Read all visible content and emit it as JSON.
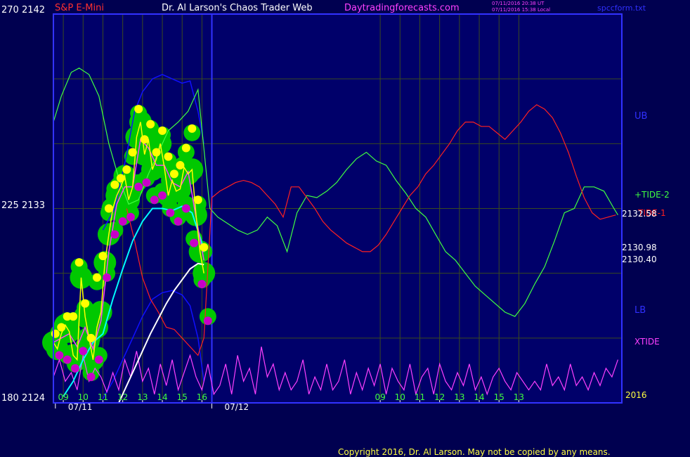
{
  "header": {
    "top_price_label": "270  2142",
    "instrument": "S&P E-Mini",
    "site_title": "Dr. Al Larson's Chaos Trader Web",
    "website": "Daytradingforecasts.com",
    "timestamp_utc": "07/11/2016 20:38 UT",
    "timestamp_local": "07/11/2016 15:38 Local",
    "filename": "spccform.txt"
  },
  "left_axis": {
    "mid_label": "225  2133",
    "bottom_label": "180  2124"
  },
  "right_labels": {
    "ub": "UB",
    "tide2": "+TIDE-2",
    "tide1": "TIDE-1",
    "price_1": "2132.58",
    "price_2": "2130.98",
    "price_3": "2130.40",
    "lb": "LB",
    "xtide": "XTIDE",
    "year": "2016"
  },
  "hour_labels": [
    "09",
    "10",
    "11",
    "12",
    "13",
    "14",
    "15",
    "16",
    "09",
    "10",
    "11",
    "12",
    "13",
    "14",
    "15",
    "13"
  ],
  "date_labels": [
    "07/11",
    "07/12"
  ],
  "copyright": "Copyright 2016, Dr. Al Larson. May not be copied by any means.",
  "colors": {
    "background": "#000050",
    "plot_area": "#00006a",
    "grid": "#3a4a20",
    "frame": "#3232ff",
    "price_bubble": "#00c800",
    "high_dot": "#ffff00",
    "low_dot": "#c800c8",
    "close_line": "#ffff00",
    "fast_ma": "#ff40ff",
    "ma_cyan": "#00ffff",
    "ma_white": "#ffffff",
    "upper_band": "#1010ff",
    "tide2": "#40ff40",
    "tide1": "#ff2020",
    "xtide": "#ff40ff",
    "header_red": "#ff3030",
    "header_pink": "#ff40ff"
  },
  "chart_data": {
    "type": "line",
    "ylim": [
      2124,
      2142
    ],
    "y_ticks": [
      2124,
      2133,
      2142
    ],
    "x_range": [
      8.5,
      37.2
    ],
    "session_break_x": 16.5,
    "series": [
      {
        "key": "price_close",
        "x": [
          8.5,
          8.7,
          8.9,
          9.1,
          9.3,
          9.5,
          9.7,
          9.9,
          10.1,
          10.3,
          10.5,
          10.7,
          10.9,
          11.1,
          11.3,
          11.5,
          11.7,
          11.9,
          12.1,
          12.3,
          12.5,
          12.7,
          12.9,
          13.1,
          13.3,
          13.5,
          13.7,
          13.9,
          14.1,
          14.3,
          14.5,
          14.7,
          14.9,
          15.1,
          15.3,
          15.5,
          15.7,
          15.9,
          16.1
        ],
        "y": [
          2126.8,
          2126.5,
          2127.2,
          2127.6,
          2127.3,
          2126.2,
          2126.0,
          2129.8,
          2128.0,
          2127.0,
          2126.0,
          2127.5,
          2128.2,
          2130.5,
          2131.8,
          2133.0,
          2133.6,
          2134.0,
          2134.5,
          2133.4,
          2134.0,
          2136.3,
          2137.0,
          2135.5,
          2136.2,
          2134.8,
          2135.3,
          2136.0,
          2134.9,
          2133.6,
          2134.3,
          2133.8,
          2133.9,
          2134.9,
          2134.6,
          2134.8,
          2132.7,
          2131.0,
          2130.0
        ]
      },
      {
        "key": "fast_ma",
        "x": [
          8.5,
          8.9,
          9.3,
          9.7,
          10.1,
          10.5,
          10.9,
          11.3,
          11.7,
          12.1,
          12.5,
          12.9,
          13.3,
          13.7,
          14.1,
          14.5,
          14.9,
          15.3,
          15.7,
          16.1
        ],
        "y": [
          2126.8,
          2127.0,
          2127.2,
          2126.6,
          2127.5,
          2126.5,
          2127.8,
          2131.0,
          2133.2,
          2134.0,
          2134.0,
          2136.2,
          2135.8,
          2135.0,
          2135.0,
          2134.2,
          2134.0,
          2134.7,
          2132.6,
          2130.6
        ]
      },
      {
        "key": "ma_cyan",
        "x": [
          9.0,
          9.5,
          10.0,
          10.5,
          11.0,
          11.5,
          12.0,
          12.5,
          13.0,
          13.5,
          14.0,
          14.5,
          15.0,
          15.5,
          16.0,
          16.1
        ],
        "y": [
          2124.3,
          2125.0,
          2126.0,
          2126.8,
          2127.2,
          2128.8,
          2130.2,
          2131.5,
          2132.4,
          2133.0,
          2133.0,
          2132.9,
          2133.1,
          2132.8,
          2131.4,
          2130.98
        ]
      },
      {
        "key": "ma_white",
        "x": [
          11.8,
          12.2,
          12.6,
          13.0,
          13.4,
          13.8,
          14.2,
          14.6,
          15.0,
          15.4,
          15.8,
          16.1
        ],
        "y": [
          2124.0,
          2124.8,
          2125.6,
          2126.4,
          2127.2,
          2127.9,
          2128.6,
          2129.2,
          2129.7,
          2130.2,
          2130.45,
          2130.4
        ]
      },
      {
        "key": "upper_band",
        "x": [
          11.0,
          11.6,
          12.2,
          12.6,
          13.0,
          13.5,
          14.0,
          14.5,
          15.0,
          15.4,
          15.8,
          16.1
        ],
        "y": [
          2132.0,
          2133.0,
          2135.5,
          2137.5,
          2138.4,
          2139.0,
          2139.2,
          2139.0,
          2138.8,
          2138.9,
          2137.5,
          2136.0
        ]
      },
      {
        "key": "lower_band",
        "x": [
          11.0,
          11.5,
          12.0,
          12.5,
          13.0,
          13.5,
          14.0,
          14.5,
          15.0,
          15.4,
          15.8,
          16.1
        ],
        "y": [
          2124.2,
          2125.0,
          2126.0,
          2127.0,
          2128.0,
          2128.8,
          2129.1,
          2129.2,
          2129.0,
          2128.5,
          2127.0,
          2125.0
        ]
      },
      {
        "key": "tide2",
        "x": [
          8.5,
          8.9,
          9.4,
          9.8,
          10.3,
          10.8,
          11.3,
          11.8,
          12.3,
          12.8,
          13.3,
          13.8,
          14.3,
          14.8,
          15.3,
          15.8,
          16.4,
          16.8,
          17.3,
          17.8,
          18.3,
          18.8,
          19.3,
          19.8,
          20.3,
          20.8,
          21.3,
          21.8,
          22.3,
          22.8,
          23.3,
          23.8,
          24.3,
          24.8,
          25.3,
          25.8,
          26.3,
          26.8,
          27.3,
          27.8,
          28.3,
          28.8,
          29.3,
          29.8,
          30.3,
          30.8,
          31.3,
          31.8,
          32.3,
          32.8,
          33.3,
          33.8,
          34.3,
          34.8,
          35.3,
          35.8,
          36.3,
          36.8,
          37.0
        ],
        "y": [
          2137.0,
          2138.2,
          2139.3,
          2139.5,
          2139.2,
          2138.2,
          2136.0,
          2134.4,
          2133.2,
          2133.4,
          2134.6,
          2135.6,
          2136.6,
          2137.0,
          2137.5,
          2138.5,
          2133.0,
          2132.6,
          2132.3,
          2132.0,
          2131.8,
          2132.0,
          2132.6,
          2132.2,
          2131.0,
          2132.8,
          2133.6,
          2133.5,
          2133.8,
          2134.2,
          2134.8,
          2135.3,
          2135.6,
          2135.2,
          2135.0,
          2134.3,
          2133.7,
          2133.0,
          2132.6,
          2131.8,
          2131.0,
          2130.6,
          2130.0,
          2129.4,
          2129.0,
          2128.6,
          2128.2,
          2128.0,
          2128.6,
          2129.5,
          2130.3,
          2131.5,
          2132.8,
          2133.0,
          2134.0,
          2134.0,
          2133.8,
          2133.0,
          2132.7
        ],
        "name": "+TIDE-2"
      },
      {
        "key": "tide1",
        "x": [
          12.2,
          12.6,
          13.0,
          13.4,
          13.8,
          14.2,
          14.6,
          15.0,
          15.4,
          15.8,
          16.1,
          16.5,
          16.9,
          17.3,
          17.7,
          18.1,
          18.5,
          18.9,
          19.3,
          19.7,
          20.1,
          20.5,
          20.9,
          21.3,
          21.7,
          22.1,
          22.5,
          22.9,
          23.3,
          23.7,
          24.1,
          24.5,
          24.9,
          25.3,
          25.7,
          26.1,
          26.5,
          26.9,
          27.3,
          27.7,
          28.1,
          28.5,
          28.9,
          29.3,
          29.7,
          30.1,
          30.5,
          30.9,
          31.3,
          31.7,
          32.1,
          32.5,
          32.9,
          33.3,
          33.7,
          34.1,
          34.5,
          34.9,
          35.3,
          35.7,
          36.1,
          36.5,
          36.9
        ],
        "y": [
          2133.0,
          2131.5,
          2129.8,
          2128.8,
          2128.2,
          2127.5,
          2127.4,
          2127.0,
          2126.6,
          2126.2,
          2127.0,
          2133.5,
          2133.8,
          2134.0,
          2134.2,
          2134.3,
          2134.2,
          2134.0,
          2133.6,
          2133.2,
          2132.6,
          2134.0,
          2134.0,
          2133.5,
          2133.0,
          2132.4,
          2132.0,
          2131.7,
          2131.4,
          2131.2,
          2131.0,
          2131.0,
          2131.3,
          2131.8,
          2132.4,
          2133.0,
          2133.6,
          2134.0,
          2134.6,
          2135.0,
          2135.5,
          2136.0,
          2136.6,
          2137.0,
          2137.0,
          2136.8,
          2136.8,
          2136.5,
          2136.2,
          2136.6,
          2137.0,
          2137.5,
          2137.8,
          2137.6,
          2137.2,
          2136.5,
          2135.6,
          2134.5,
          2133.5,
          2132.8,
          2132.5,
          2132.6,
          2132.7
        ],
        "name": "TIDE-1"
      },
      {
        "key": "xtide",
        "x": [
          8.5,
          8.8,
          9.1,
          9.4,
          9.7,
          10.0,
          10.3,
          10.6,
          10.9,
          11.2,
          11.5,
          11.8,
          12.1,
          12.4,
          12.7,
          13.0,
          13.3,
          13.6,
          13.9,
          14.2,
          14.5,
          14.8,
          15.1,
          15.4,
          15.7,
          16.0,
          16.3,
          16.6,
          16.9,
          17.2,
          17.5,
          17.8,
          18.1,
          18.4,
          18.7,
          19.0,
          19.3,
          19.6,
          19.9,
          20.2,
          20.5,
          20.8,
          21.1,
          21.4,
          21.7,
          22.0,
          22.3,
          22.6,
          22.9,
          23.2,
          23.5,
          23.8,
          24.1,
          24.4,
          24.7,
          25.0,
          25.3,
          25.6,
          25.9,
          26.2,
          26.5,
          26.8,
          27.1,
          27.4,
          27.7,
          28.0,
          28.3,
          28.6,
          28.9,
          29.2,
          29.5,
          29.8,
          30.1,
          30.4,
          30.7,
          31.0,
          31.3,
          31.6,
          31.9,
          32.2,
          32.5,
          32.8,
          33.1,
          33.4,
          33.7,
          34.0,
          34.3,
          34.6,
          34.9,
          35.2,
          35.5,
          35.8,
          36.1,
          36.4,
          36.7,
          37.0
        ],
        "y": [
          2125.2,
          2126.0,
          2125.0,
          2125.4,
          2124.6,
          2126.2,
          2125.0,
          2125.6,
          2125.2,
          2124.5,
          2125.4,
          2124.6,
          2126.0,
          2125.2,
          2126.4,
          2125.0,
          2125.6,
          2124.4,
          2125.8,
          2124.8,
          2126.0,
          2124.6,
          2125.4,
          2126.2,
          2125.2,
          2124.6,
          2125.8,
          2124.4,
          2124.8,
          2125.8,
          2124.4,
          2126.2,
          2125.0,
          2125.6,
          2124.4,
          2126.6,
          2125.2,
          2125.8,
          2124.6,
          2125.4,
          2124.6,
          2125.0,
          2126.0,
          2124.4,
          2125.2,
          2124.6,
          2125.8,
          2124.6,
          2125.0,
          2126.0,
          2124.4,
          2125.4,
          2124.6,
          2125.6,
          2124.8,
          2125.8,
          2124.4,
          2125.6,
          2125.0,
          2124.6,
          2125.8,
          2124.4,
          2125.2,
          2125.6,
          2124.4,
          2125.8,
          2125.0,
          2124.6,
          2125.4,
          2124.8,
          2125.8,
          2124.6,
          2125.2,
          2124.4,
          2125.2,
          2125.6,
          2125.0,
          2124.6,
          2125.4,
          2125.0,
          2124.6,
          2125.0,
          2124.6,
          2125.8,
          2124.8,
          2125.2,
          2124.6,
          2125.8,
          2124.8,
          2125.2,
          2124.6,
          2125.4,
          2124.8,
          2125.6,
          2125.2,
          2126.0
        ],
        "name": "XTIDE"
      }
    ],
    "highs": {
      "x": [
        8.6,
        8.9,
        9.2,
        9.5,
        9.8,
        10.1,
        10.4,
        10.7,
        11.0,
        11.3,
        11.6,
        11.9,
        12.2,
        12.5,
        12.8,
        13.1,
        13.4,
        13.7,
        14.0,
        14.3,
        14.6,
        14.9,
        15.2,
        15.5,
        15.8,
        16.1
      ],
      "y": [
        2127.2,
        2127.5,
        2128.0,
        2128.0,
        2130.5,
        2128.6,
        2127.0,
        2129.8,
        2130.8,
        2133.0,
        2134.1,
        2134.4,
        2134.8,
        2135.6,
        2137.6,
        2136.2,
        2136.9,
        2135.6,
        2136.6,
        2135.4,
        2134.6,
        2135.0,
        2135.8,
        2136.7,
        2133.4,
        2131.2
      ]
    },
    "lows": {
      "x": [
        8.8,
        9.2,
        9.6,
        10.0,
        10.4,
        10.8,
        11.2,
        11.6,
        12.0,
        12.4,
        12.8,
        13.2,
        13.6,
        14.0,
        14.4,
        14.8,
        15.2,
        15.6,
        16.0,
        16.3
      ],
      "y": [
        2126.2,
        2126.0,
        2125.6,
        2126.4,
        2125.2,
        2126.0,
        2129.8,
        2131.8,
        2132.4,
        2132.6,
        2134.0,
        2134.2,
        2133.4,
        2133.6,
        2132.8,
        2132.4,
        2133.0,
        2131.4,
        2129.5,
        2127.8
      ]
    },
    "price_labels": [
      2132.58,
      2130.98,
      2130.4
    ]
  }
}
